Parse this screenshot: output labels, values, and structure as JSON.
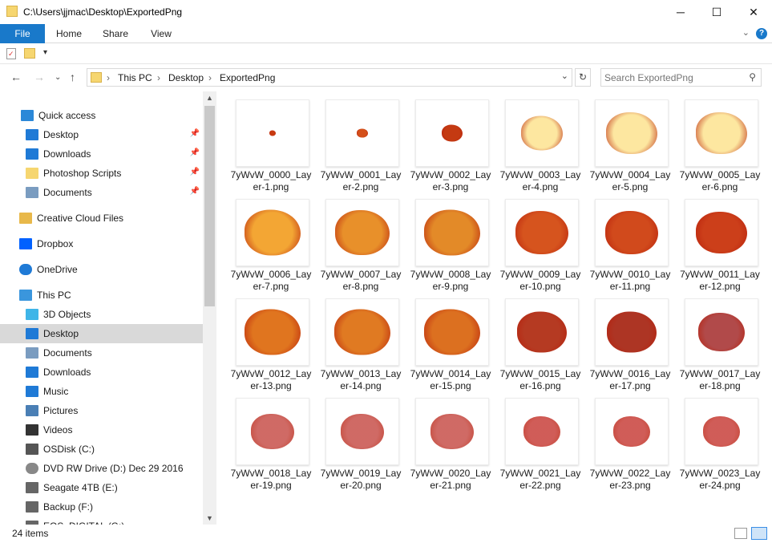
{
  "window": {
    "title": "C:\\Users\\jjmac\\Desktop\\ExportedPng",
    "minimize": "─",
    "maximize": "☐",
    "close": "✕"
  },
  "ribbon": {
    "tabs": [
      "File",
      "Home",
      "Share",
      "View"
    ],
    "help": "?"
  },
  "address": {
    "crumbs": [
      "This PC",
      "Desktop",
      "ExportedPng"
    ],
    "search_placeholder": "Search ExportedPng"
  },
  "sidebar": {
    "items": [
      {
        "label": "Quick access",
        "icon": "star-icon",
        "color": "#2b88d8",
        "pin": false
      },
      {
        "label": "Desktop",
        "icon": "desktop-icon",
        "color": "#1f7ad6",
        "pin": true
      },
      {
        "label": "Downloads",
        "icon": "download-icon",
        "color": "#1f7ad6",
        "pin": true
      },
      {
        "label": "Photoshop Scripts",
        "icon": "folder-icon",
        "color": "#f6d670",
        "pin": true
      },
      {
        "label": "Documents",
        "icon": "documents-icon",
        "color": "#7a9cc0",
        "pin": true
      },
      {
        "label": "Creative Cloud Files",
        "icon": "creative-cloud-icon",
        "color": "#e8b84a",
        "pin": false
      },
      {
        "label": "Dropbox",
        "icon": "dropbox-icon",
        "color": "#0061ff",
        "pin": false
      },
      {
        "label": "OneDrive",
        "icon": "onedrive-icon",
        "color": "#1f7ad6",
        "pin": false
      },
      {
        "label": "This PC",
        "icon": "pc-icon",
        "color": "#3a96dd",
        "pin": false
      },
      {
        "label": "3D Objects",
        "icon": "cube-icon",
        "color": "#3fb5e8",
        "pin": false
      },
      {
        "label": "Desktop",
        "icon": "desktop-icon",
        "color": "#1f7ad6",
        "pin": false
      },
      {
        "label": "Documents",
        "icon": "documents-icon",
        "color": "#7a9cc0",
        "pin": false
      },
      {
        "label": "Downloads",
        "icon": "download-icon",
        "color": "#1f7ad6",
        "pin": false
      },
      {
        "label": "Music",
        "icon": "music-icon",
        "color": "#1f7ad6",
        "pin": false
      },
      {
        "label": "Pictures",
        "icon": "pictures-icon",
        "color": "#4a7fb5",
        "pin": false
      },
      {
        "label": "Videos",
        "icon": "videos-icon",
        "color": "#333",
        "pin": false
      },
      {
        "label": "OSDisk (C:)",
        "icon": "drive-icon",
        "color": "#555",
        "pin": false
      },
      {
        "label": "DVD RW Drive (D:) Dec 29 2016",
        "icon": "dvd-icon",
        "color": "#888",
        "pin": false
      },
      {
        "label": "Seagate 4TB (E:)",
        "icon": "drive-icon",
        "color": "#666",
        "pin": false
      },
      {
        "label": "Backup (F:)",
        "icon": "drive-icon",
        "color": "#666",
        "pin": false
      },
      {
        "label": "EOS_DIGITAL (G:)",
        "icon": "drive-icon",
        "color": "#666",
        "pin": false
      }
    ],
    "selected_index": 10
  },
  "files": [
    {
      "line1": "7yWvW_0000_Lay",
      "line2": "er-1.png"
    },
    {
      "line1": "7yWvW_0001_Lay",
      "line2": "er-2.png"
    },
    {
      "line1": "7yWvW_0002_Lay",
      "line2": "er-3.png"
    },
    {
      "line1": "7yWvW_0003_Lay",
      "line2": "er-4.png"
    },
    {
      "line1": "7yWvW_0004_Lay",
      "line2": "er-5.png"
    },
    {
      "line1": "7yWvW_0005_Lay",
      "line2": "er-6.png"
    },
    {
      "line1": "7yWvW_0006_Lay",
      "line2": "er-7.png"
    },
    {
      "line1": "7yWvW_0007_Lay",
      "line2": "er-8.png"
    },
    {
      "line1": "7yWvW_0008_Lay",
      "line2": "er-9.png"
    },
    {
      "line1": "7yWvW_0009_Lay",
      "line2": "er-10.png"
    },
    {
      "line1": "7yWvW_0010_Lay",
      "line2": "er-11.png"
    },
    {
      "line1": "7yWvW_0011_Lay",
      "line2": "er-12.png"
    },
    {
      "line1": "7yWvW_0012_Lay",
      "line2": "er-13.png"
    },
    {
      "line1": "7yWvW_0013_Lay",
      "line2": "er-14.png"
    },
    {
      "line1": "7yWvW_0014_Lay",
      "line2": "er-15.png"
    },
    {
      "line1": "7yWvW_0015_Lay",
      "line2": "er-16.png"
    },
    {
      "line1": "7yWvW_0016_Lay",
      "line2": "er-17.png"
    },
    {
      "line1": "7yWvW_0017_Lay",
      "line2": "er-18.png"
    },
    {
      "line1": "7yWvW_0018_Lay",
      "line2": "er-19.png"
    },
    {
      "line1": "7yWvW_0019_Lay",
      "line2": "er-20.png"
    },
    {
      "line1": "7yWvW_0020_Lay",
      "line2": "er-21.png"
    },
    {
      "line1": "7yWvW_0021_Lay",
      "line2": "er-22.png"
    },
    {
      "line1": "7yWvW_0022_Lay",
      "line2": "er-23.png"
    },
    {
      "line1": "7yWvW_0023_Lay",
      "line2": "er-24.png"
    }
  ],
  "thumb_colors": [
    "#c83a10",
    "#d4501a",
    "#c43a12",
    "#fde7a0",
    "#fde7a0",
    "#fde7a0",
    "#f3a634",
    "#e8902a",
    "#e38a28",
    "#d6541e",
    "#d14a1c",
    "#cc3f1a",
    "#e0751f",
    "#e07a22",
    "#dc7020",
    "#b53a22",
    "#ad3524",
    "#b14a4a",
    "#c7504a",
    "#c7504a",
    "#c7504a",
    "#c8403a",
    "#c8403a",
    "#c8403a"
  ],
  "status": {
    "count": "24 items"
  }
}
